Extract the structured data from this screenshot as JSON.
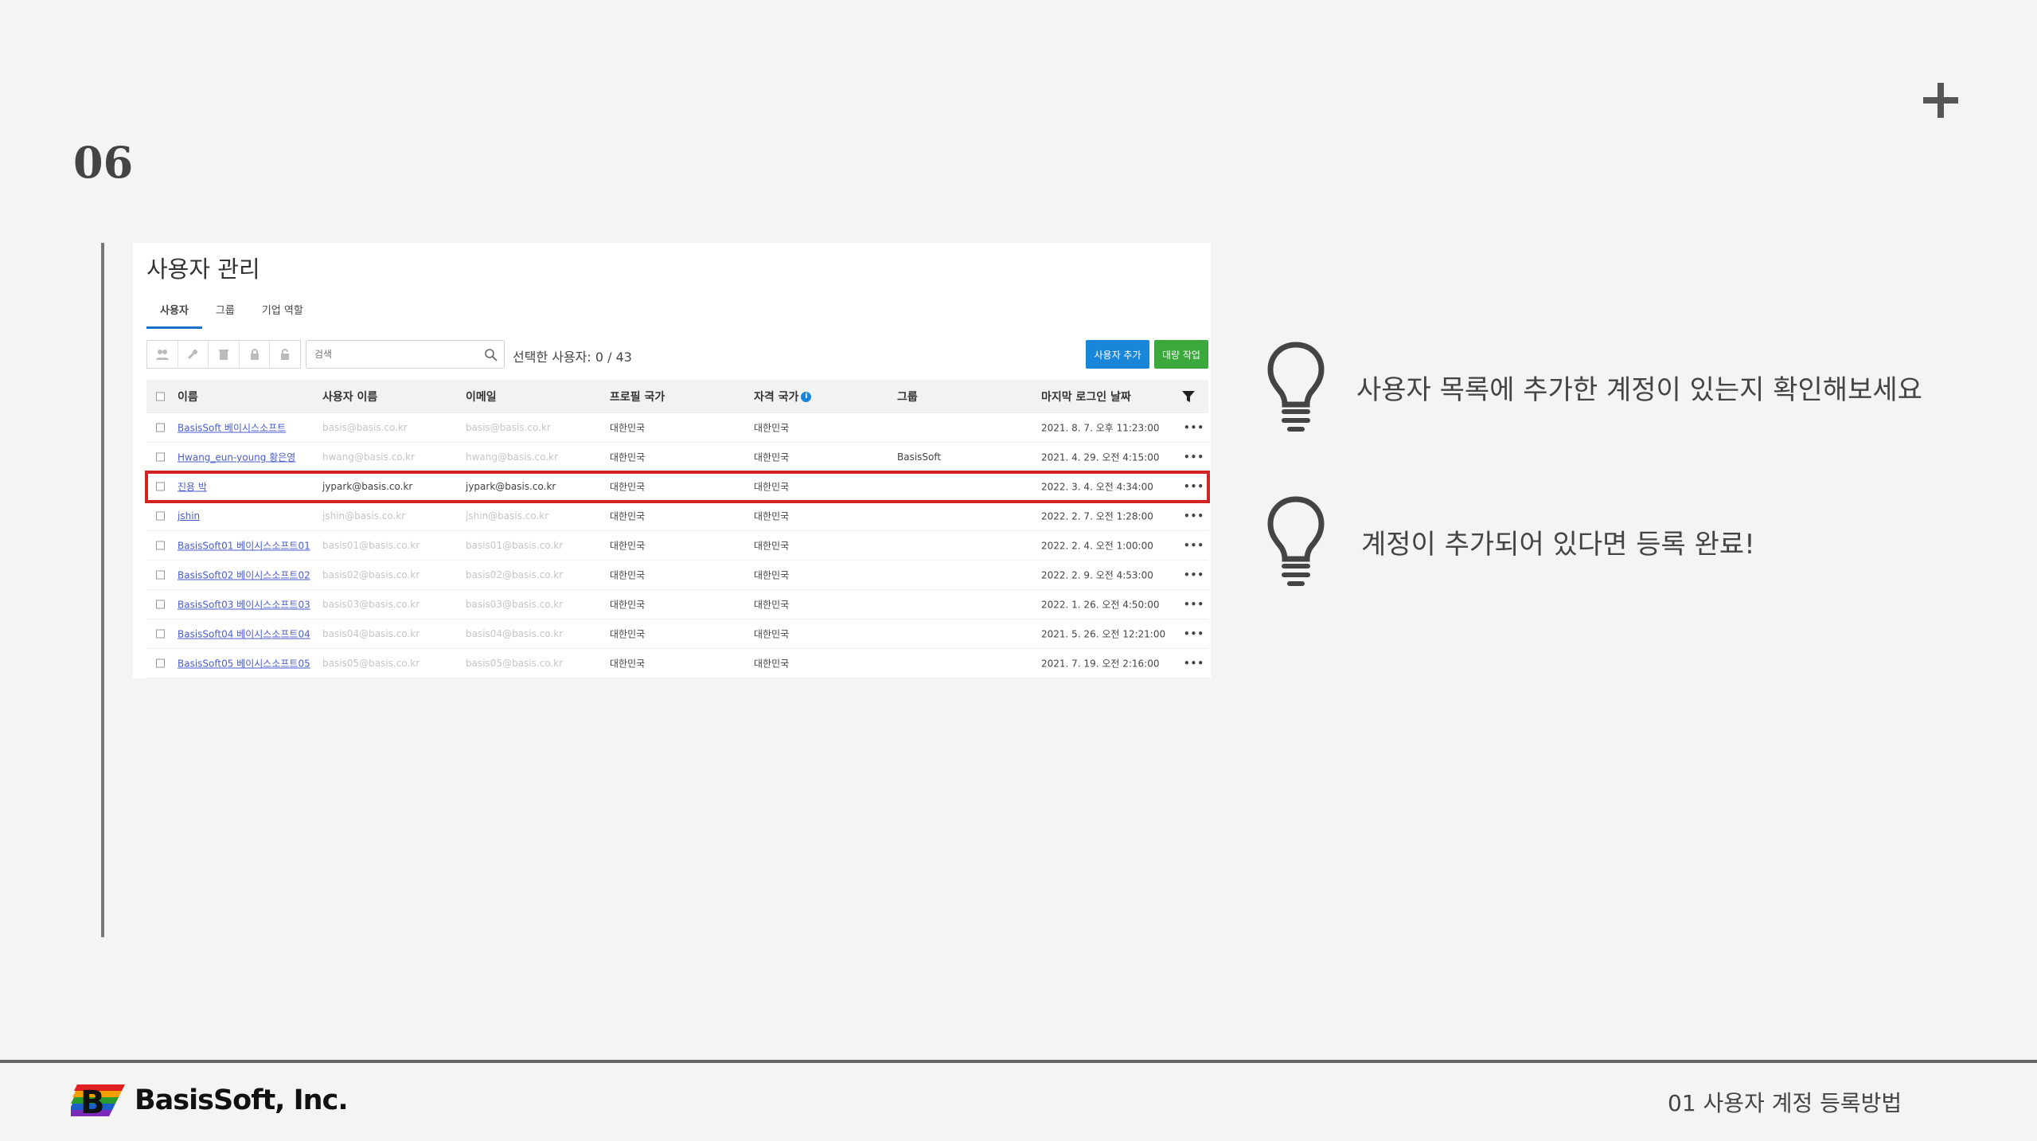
{
  "slide": {
    "number": "06"
  },
  "panel": {
    "title": "사용자 관리",
    "tabs": [
      "사용자",
      "그룹",
      "기업 역할"
    ],
    "search_placeholder": "검색",
    "selected_users": "선택한 사용자: 0 / 43",
    "add_user_button": "사용자 추가",
    "bulk_button": "대량 작업",
    "columns": [
      "이름",
      "사용자 이름",
      "이메일",
      "프로필 국가",
      "자격 국가",
      "그룹",
      "마지막 로그인 날짜"
    ],
    "rows": [
      {
        "name": "BasisSoft 베이시스소프트",
        "username": "basis@basis.co.kr",
        "email": "basis@basis.co.kr",
        "profile": "대한민국",
        "cred": "대한민국",
        "group": "",
        "login": "2021. 8. 7. 오후 11:23:00"
      },
      {
        "name": "Hwang_eun-young 황은영",
        "username": "hwang@basis.co.kr",
        "email": "hwang@basis.co.kr",
        "profile": "대한민국",
        "cred": "대한민국",
        "group": "BasisSoft",
        "login": "2021. 4. 29. 오전 4:15:00"
      },
      {
        "name": "진용 박",
        "username": "jypark@basis.co.kr",
        "email": "jypark@basis.co.kr",
        "profile": "대한민국",
        "cred": "대한민국",
        "group": "",
        "login": "2022. 3. 4. 오전 4:34:00"
      },
      {
        "name": "jshin",
        "username": "jshin@basis.co.kr",
        "email": "jshin@basis.co.kr",
        "profile": "대한민국",
        "cred": "대한민국",
        "group": "",
        "login": "2022. 2. 7. 오전 1:28:00"
      },
      {
        "name": "BasisSoft01 베이시스소프트01",
        "username": "basis01@basis.co.kr",
        "email": "basis01@basis.co.kr",
        "profile": "대한민국",
        "cred": "대한민국",
        "group": "",
        "login": "2022. 2. 4. 오전 1:00:00"
      },
      {
        "name": "BasisSoft02 베이시스소프트02",
        "username": "basis02@basis.co.kr",
        "email": "basis02@basis.co.kr",
        "profile": "대한민국",
        "cred": "대한민국",
        "group": "",
        "login": "2022. 2. 9. 오전 4:53:00"
      },
      {
        "name": "BasisSoft03 베이시스소프트03",
        "username": "basis03@basis.co.kr",
        "email": "basis03@basis.co.kr",
        "profile": "대한민국",
        "cred": "대한민국",
        "group": "",
        "login": "2022. 1. 26. 오전 4:50:00"
      },
      {
        "name": "BasisSoft04 베이시스소프트04",
        "username": "basis04@basis.co.kr",
        "email": "basis04@basis.co.kr",
        "profile": "대한민국",
        "cred": "대한민국",
        "group": "",
        "login": "2021. 5. 26. 오전 12:21:00"
      },
      {
        "name": "BasisSoft05 베이시스소프트05",
        "username": "basis05@basis.co.kr",
        "email": "basis05@basis.co.kr",
        "profile": "대한민국",
        "cred": "대한민국",
        "group": "",
        "login": "2021. 7. 19. 오전 2:16:00"
      }
    ],
    "highlighted_row": 2
  },
  "tips": [
    {
      "icon": "lightbulb-icon",
      "text": "사용자 목록에 추가한 계정이 있는지 확인해보세요"
    },
    {
      "icon": "lightbulb-icon",
      "text": "계정이 추가되어 있다면 등록 완료!"
    }
  ],
  "footer": {
    "logo_text": "BasisSoft, Inc.",
    "caption": "01 사용자 계정 등록방법"
  },
  "colors": {
    "accent_blue": "#1a86d9",
    "accent_green": "#3aa83a",
    "highlight_red": "#d42323"
  }
}
